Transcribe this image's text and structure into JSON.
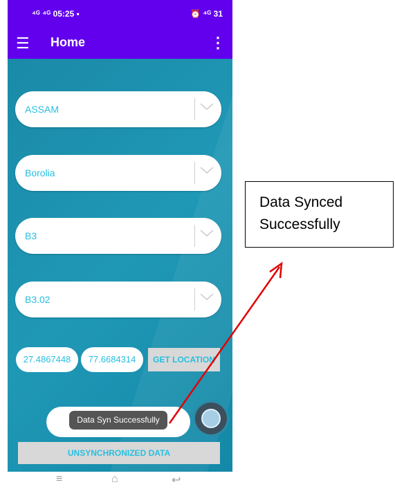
{
  "status_bar": {
    "left": "⁴ᴳ ⁴ᴳ 05:25 ▪",
    "right": "⏰ ⁴ᴳ 31"
  },
  "app_bar": {
    "title": "Home"
  },
  "dropdowns": [
    {
      "value": "ASSAM"
    },
    {
      "value": "Borolia"
    },
    {
      "value": "B3"
    },
    {
      "value": "B3.02"
    }
  ],
  "coordinates": {
    "latitude": "27.4867448",
    "longitude": "77.6684314"
  },
  "buttons": {
    "get_location": "GET LOCATION",
    "unsynchronized": "UNSYNCHRONIZED DATA"
  },
  "toast": {
    "message": "Data Syn Successfully"
  },
  "callout": {
    "text": "Data Synced Successfully"
  },
  "colors": {
    "app_bar": "#6200ee",
    "background": "#1a8aa8",
    "text_accent": "#26bfe0",
    "arrow": "#e00000"
  }
}
